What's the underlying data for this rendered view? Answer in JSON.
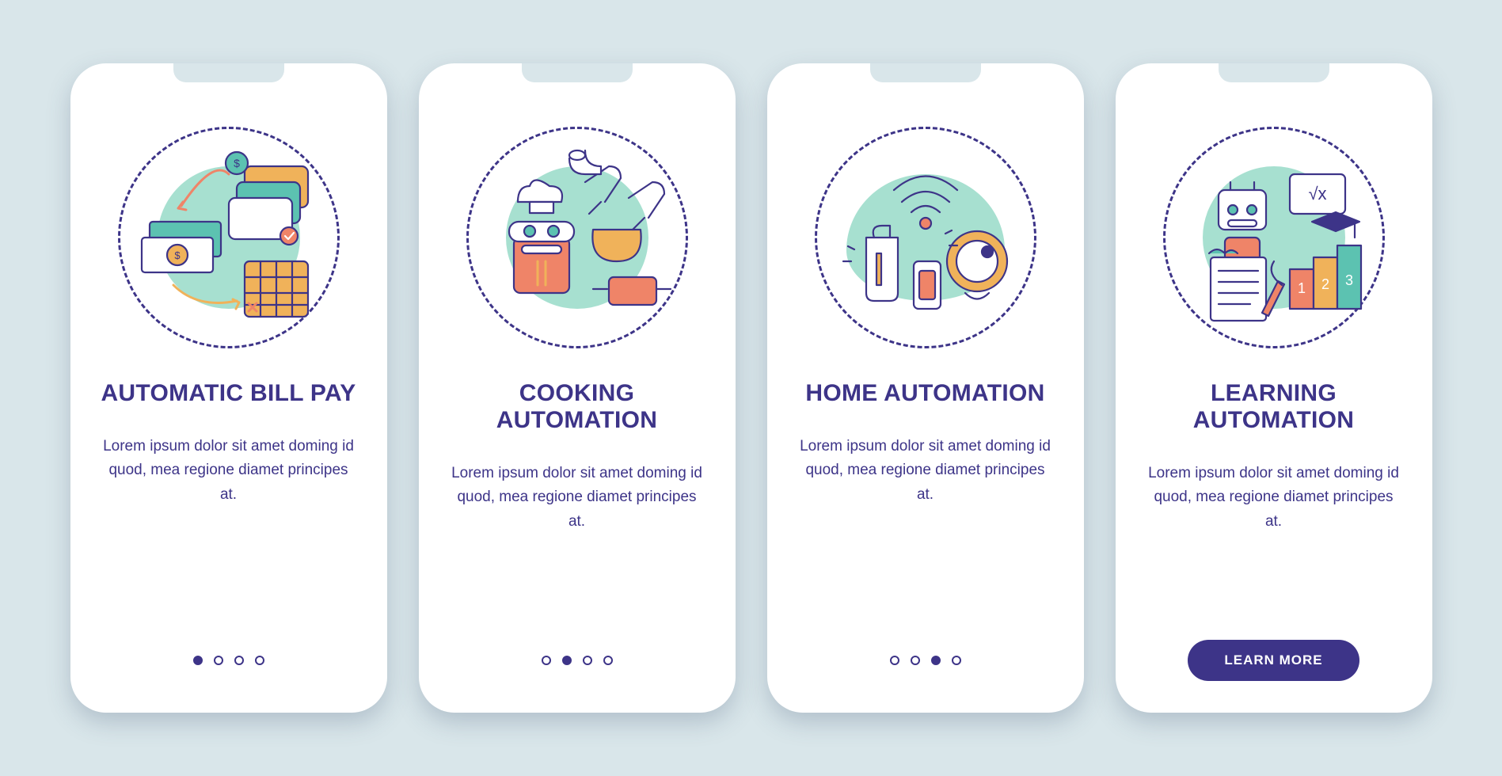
{
  "screens": [
    {
      "title": "Automatic Bill Pay",
      "description": "Lorem ipsum dolor sit amet doming id quod, mea regione diamet principes at.",
      "icon": "bill-pay-illustration",
      "active_dot": 0,
      "show_button": false
    },
    {
      "title": "Cooking Automation",
      "description": "Lorem ipsum dolor sit amet doming id quod, mea regione diamet principes at.",
      "icon": "cooking-illustration",
      "active_dot": 1,
      "show_button": false
    },
    {
      "title": "Home Automation",
      "description": "Lorem ipsum dolor sit amet doming id quod, mea regione diamet principes at.",
      "icon": "home-illustration",
      "active_dot": 2,
      "show_button": false
    },
    {
      "title": "Learning Automation",
      "description": "Lorem ipsum dolor sit amet doming id quod, mea regione diamet principes at.",
      "icon": "learning-illustration",
      "active_dot": 3,
      "show_button": true
    }
  ],
  "button_label": "LEARN MORE",
  "colors": {
    "primary": "#3d3488",
    "mint": "#a7e0d0",
    "orange": "#f0b25a",
    "coral": "#ef8468",
    "teal": "#5cc2b1",
    "bg": "#d9e6ea"
  }
}
